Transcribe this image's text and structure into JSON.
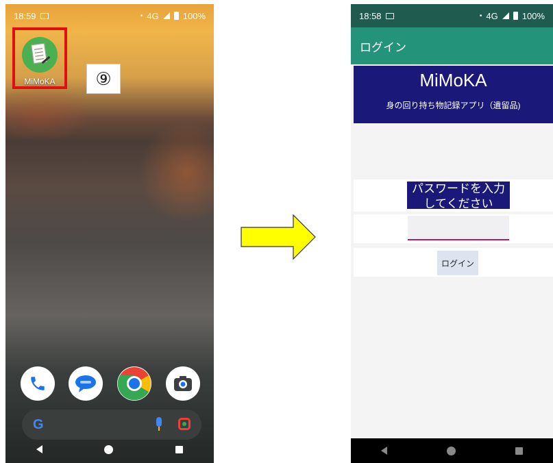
{
  "left_screen": {
    "status": {
      "time": "18:59",
      "network": "4G",
      "battery": "100%"
    },
    "app": {
      "name": "MiMoKA"
    },
    "step_marker": "⑨",
    "dock": [
      "phone-icon",
      "messages-icon",
      "chrome-icon",
      "camera-icon"
    ],
    "search_logo": "G"
  },
  "right_screen": {
    "status": {
      "time": "18:58",
      "network": "4G",
      "battery": "100%"
    },
    "app_bar_title": "ログイン",
    "banner": {
      "title": "MiMoKA",
      "subtitle": "身の回り持ち物記録アプリ（遺留品)"
    },
    "password_label": "パスワードを入力してください",
    "password_value": "",
    "login_button": "ログイン"
  },
  "colors": {
    "highlight": "#e01010",
    "arrow_fill": "#ffff00",
    "app_bar": "#239479",
    "status_bar": "#1f5b4e",
    "banner": "#1a1879",
    "input_underline": "#c2185b"
  }
}
